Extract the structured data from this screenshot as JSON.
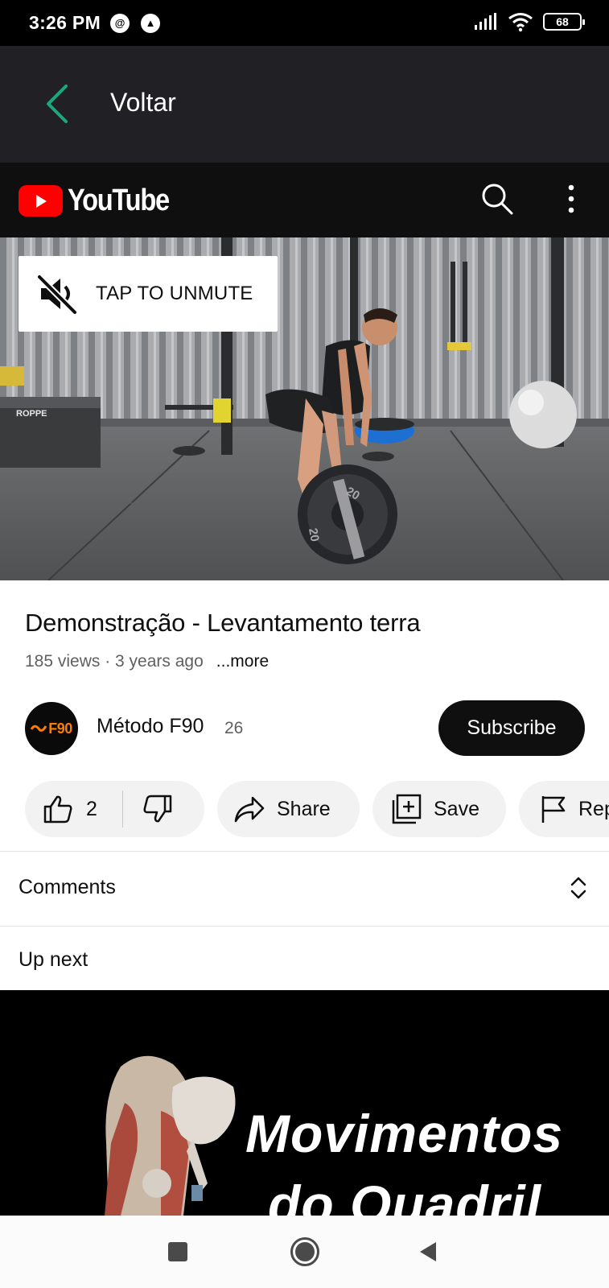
{
  "status_bar": {
    "time": "3:26 PM",
    "battery": "68"
  },
  "app_header": {
    "back_label": "Voltar",
    "accent_color": "#19a97b"
  },
  "youtube": {
    "wordmark": "YouTube",
    "brand_color": "#ff0000"
  },
  "player": {
    "unmute_label": "TAP TO UNMUTE",
    "plate_label": "20"
  },
  "video": {
    "title": "Demonstração - Levantamento terra",
    "meta": "185 views · 3 years ago",
    "more_label": "...more"
  },
  "channel": {
    "avatar_text": "F90",
    "name": "Método F90",
    "subscriber_count": "26",
    "subscribe_label": "Subscribe"
  },
  "actions": {
    "like_count": "2",
    "share_label": "Share",
    "save_label": "Save",
    "report_label": "Report"
  },
  "comments": {
    "label": "Comments"
  },
  "up_next": {
    "label": "Up next",
    "thumbnail_line1": "Movimentos",
    "thumbnail_line2": "do Quadril"
  }
}
